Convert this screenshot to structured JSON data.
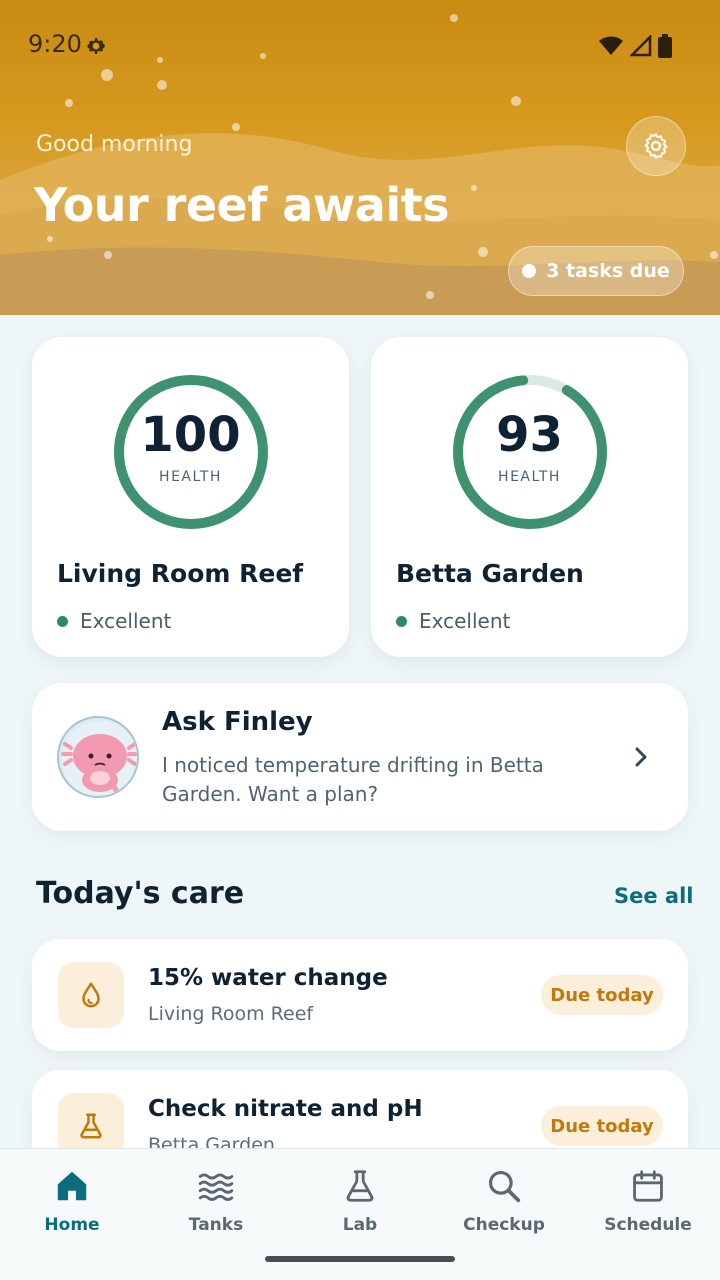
{
  "status_bar": {
    "time": "9:20"
  },
  "header": {
    "greeting": "Good morning",
    "headline": "Your reef awaits",
    "tasks_pill": "3 tasks due"
  },
  "tanks": [
    {
      "name": "Living Room Reef",
      "health": "100",
      "health_fraction": 1.0,
      "health_label": "HEALTH",
      "status": "Excellent"
    },
    {
      "name": "Betta Garden",
      "health": "93",
      "health_fraction": 0.93,
      "health_label": "HEALTH",
      "status": "Excellent"
    }
  ],
  "finley": {
    "title": "Ask Finley",
    "message": "I noticed temperature drifting in Betta Garden. Want a plan?"
  },
  "care": {
    "title": "Today's care",
    "see_all": "See all",
    "tasks": [
      {
        "title": "15% water change",
        "tank": "Living Room Reef",
        "due": "Due today",
        "icon": "water-drop-icon"
      },
      {
        "title": "Check nitrate and pH",
        "tank": "Betta Garden",
        "due": "Due today",
        "icon": "flask-icon"
      }
    ]
  },
  "nav": {
    "items": [
      {
        "label": "Home",
        "icon": "home-icon",
        "active": true
      },
      {
        "label": "Tanks",
        "icon": "waves-icon"
      },
      {
        "label": "Lab",
        "icon": "flask-icon"
      },
      {
        "label": "Checkup",
        "icon": "search-icon"
      },
      {
        "label": "Schedule",
        "icon": "calendar-icon"
      }
    ]
  },
  "colors": {
    "accent": "#0d6d7e",
    "health_ring": "#2f8a63",
    "header_gold": "#d79a1f",
    "due_text": "#c07a0c"
  }
}
